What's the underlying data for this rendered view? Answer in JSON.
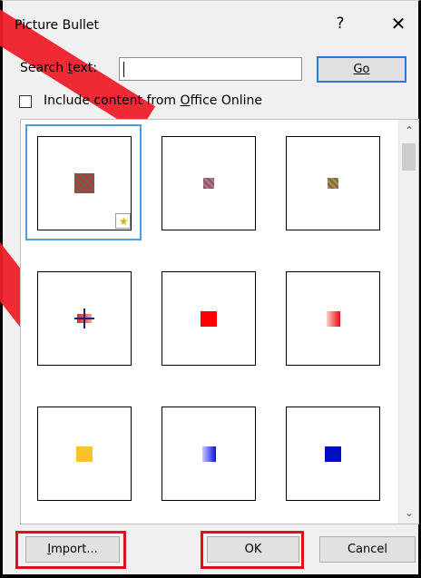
{
  "dialog": {
    "title": "Picture Bullet",
    "help_glyph": "?",
    "close_glyph": "✕"
  },
  "search": {
    "label": "Search text:",
    "value": "",
    "go_label": "Go"
  },
  "office_online": {
    "label": "Include content from Office Online",
    "checked": false
  },
  "scrollbar": {
    "up_glyph": "^",
    "down_glyph": "v"
  },
  "bullets": [
    {
      "kind": "mottled-red",
      "colors": [
        "#b23a48",
        "#5f6b3d"
      ],
      "selected": true,
      "badge_icon": "star-icon"
    },
    {
      "kind": "mottled-mauve",
      "colors": [
        "#8e5a6e",
        "#b07a8c"
      ],
      "selected": false
    },
    {
      "kind": "mottled-tan",
      "colors": [
        "#a48c5a",
        "#7a6a3c"
      ],
      "selected": false
    },
    {
      "kind": "cross",
      "colors": [
        "#d4292c",
        "#1d1f7a"
      ],
      "selected": false
    },
    {
      "kind": "solid",
      "colors": [
        "#ff0000"
      ],
      "selected": false
    },
    {
      "kind": "gradient",
      "colors": [
        "#ffcccc",
        "#e01010"
      ],
      "selected": false
    },
    {
      "kind": "solid",
      "colors": [
        "#f7c32f"
      ],
      "selected": false
    },
    {
      "kind": "gradient",
      "colors": [
        "#c8c8ff",
        "#1010e0"
      ],
      "selected": false
    },
    {
      "kind": "solid",
      "colors": [
        "#0010c0"
      ],
      "selected": false
    }
  ],
  "buttons": {
    "import": "Import...",
    "ok": "OK",
    "cancel": "Cancel"
  },
  "colors": {
    "highlight": "#e0101a",
    "focus_blue": "#2a78d3"
  }
}
